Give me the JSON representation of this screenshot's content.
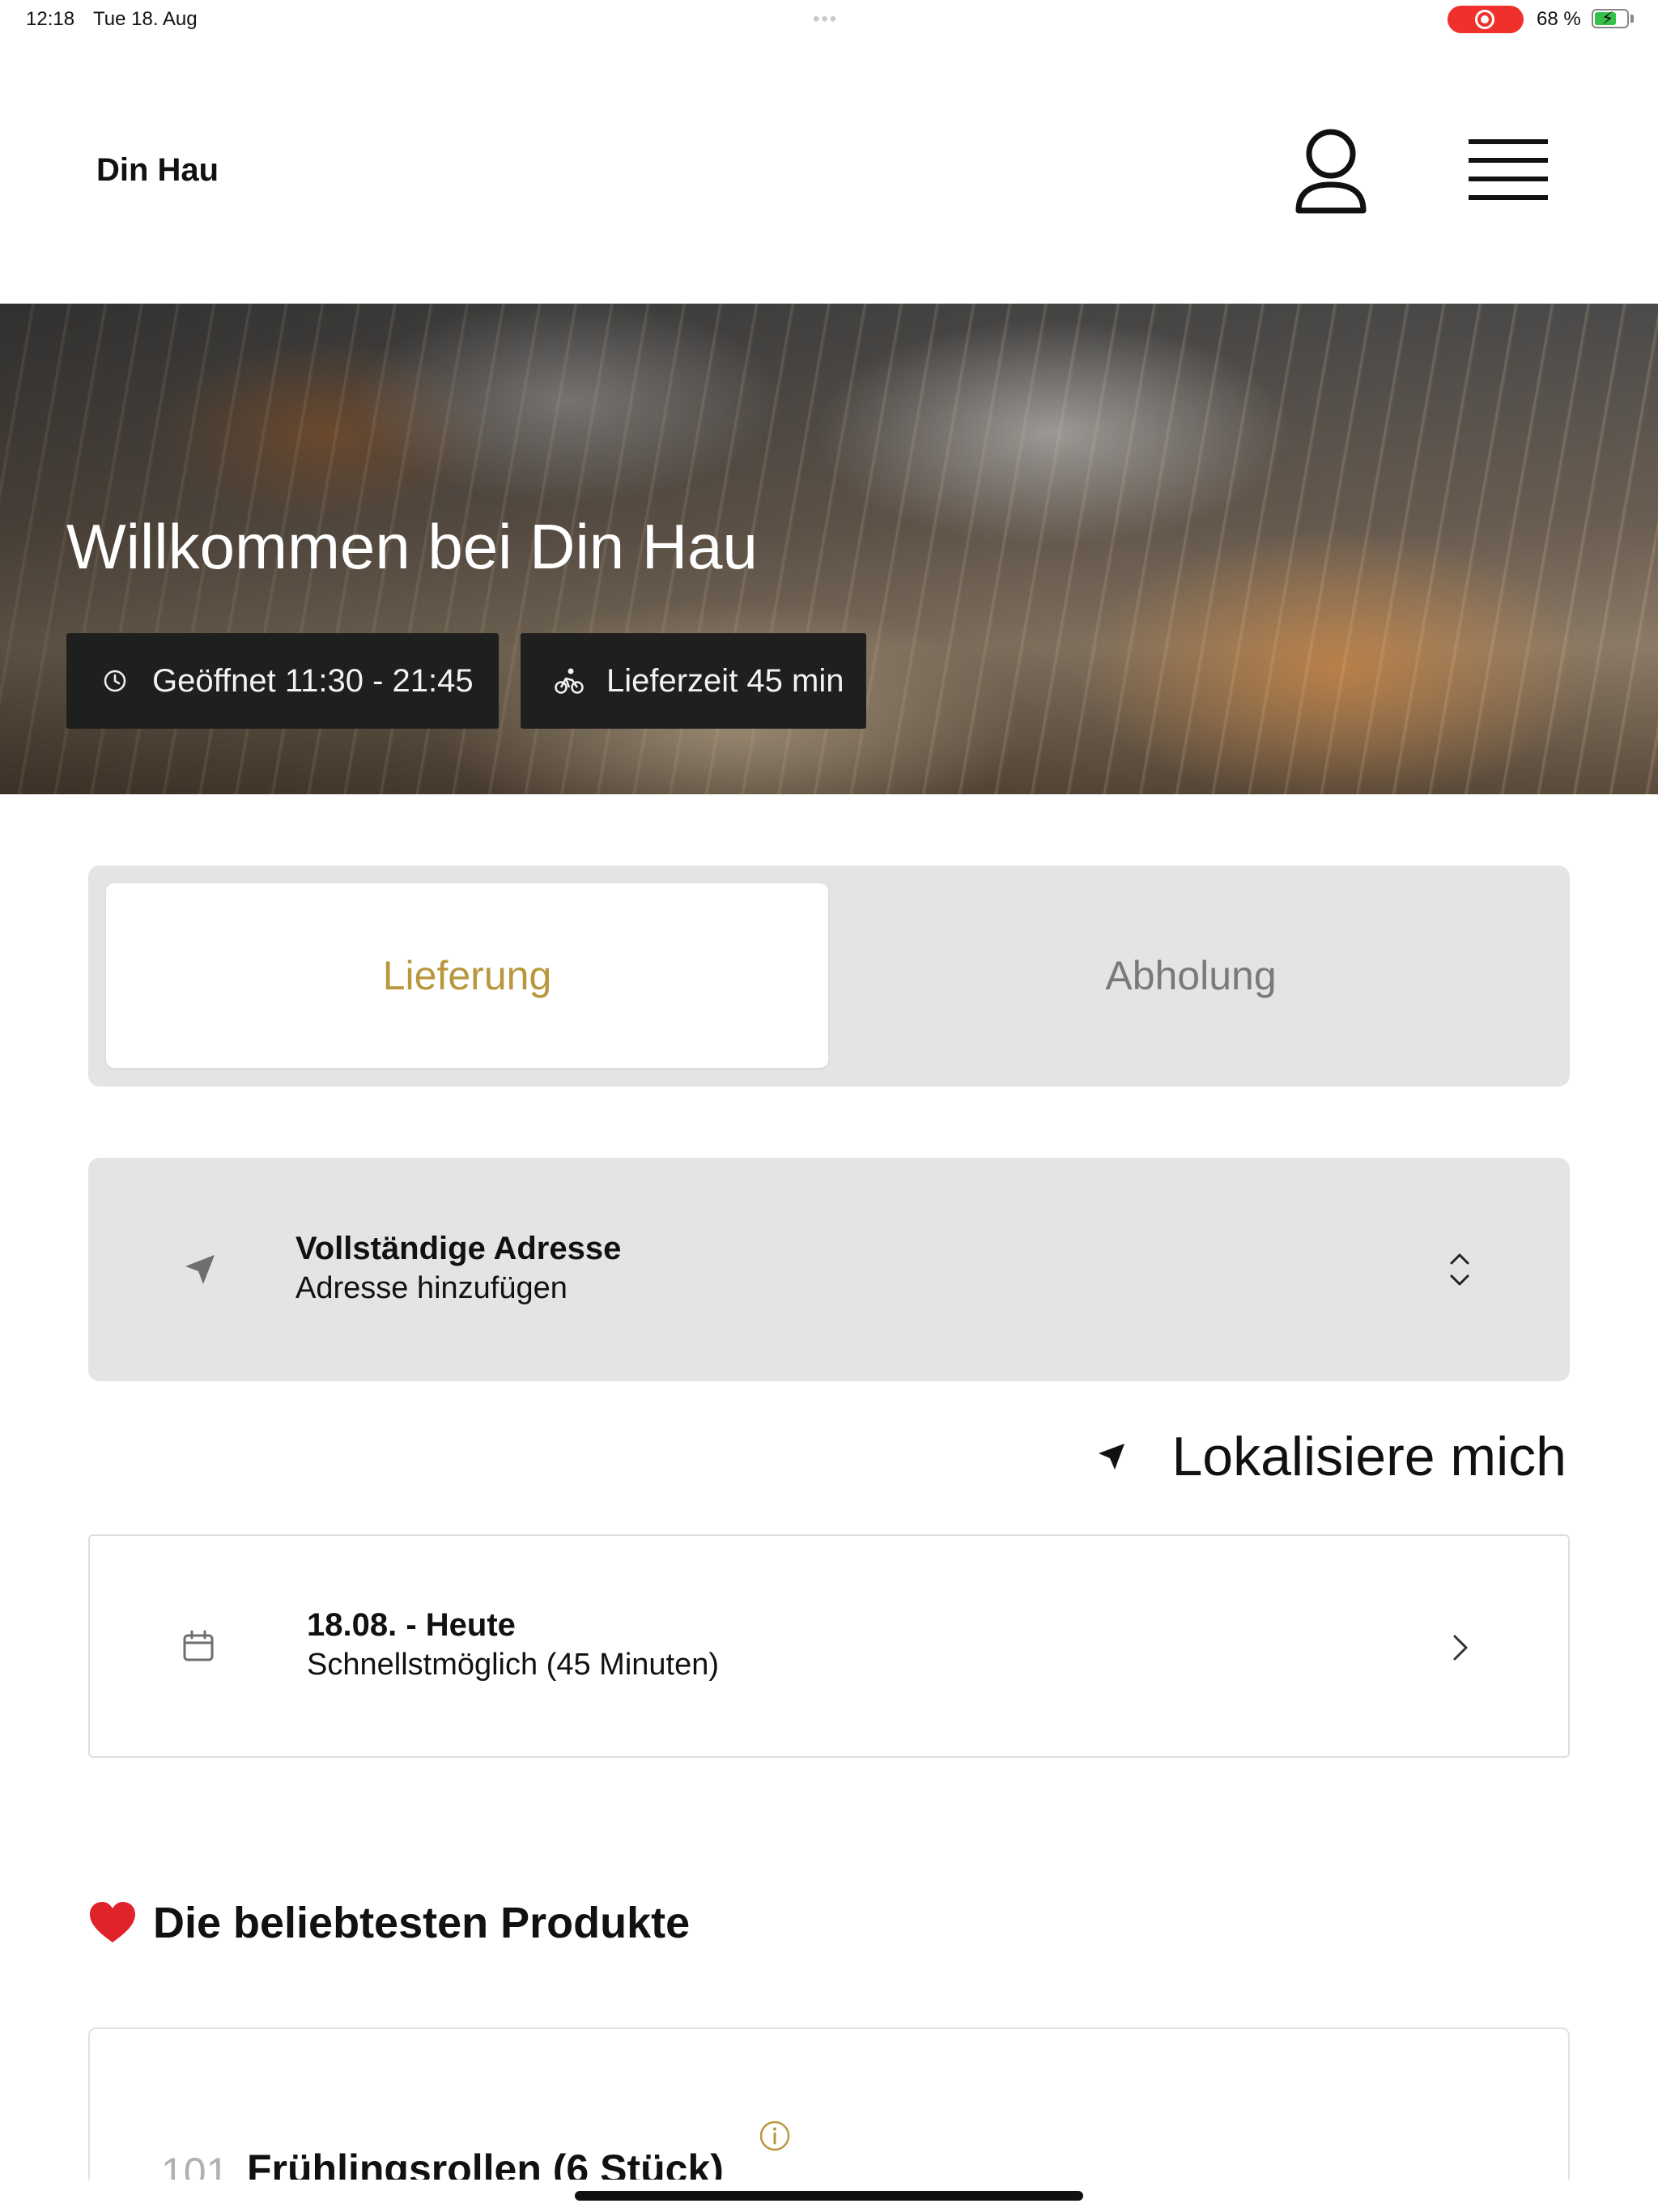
{
  "status_bar": {
    "time": "12:18",
    "date": "Tue 18. Aug",
    "battery": "68 %",
    "battery_level": 0.68,
    "recording_color": "#f0302a"
  },
  "header": {
    "brand": "Din Hau",
    "profile_icon": "person-icon",
    "menu_icon": "hamburger-menu-icon"
  },
  "hero": {
    "title": "Willkommen bei Din Hau",
    "opening_hours": "Geöffnet 11:30 - 21:45",
    "delivery_time": "Lieferzeit 45 min",
    "opening_icon": "clock-icon",
    "delivery_icon": "bicycle-icon"
  },
  "order_mode": {
    "delivery": "Lieferung",
    "pickup": "Abholung",
    "selected": "delivery",
    "accent_color": "#b8973d"
  },
  "address": {
    "title": "Vollständige Adresse",
    "placeholder": "Adresse hinzufügen",
    "icon": "location-arrow-icon"
  },
  "locate": {
    "label": "Lokalisiere mich"
  },
  "schedule": {
    "title": "18.08. - Heute",
    "subtitle": "Schnellstmöglich (45 Minuten)",
    "icon": "calendar-icon"
  },
  "popular": {
    "title": "Die beliebtesten Produkte",
    "icon": "heart-icon",
    "products": [
      {
        "number": "101",
        "name": "Frühlingsrollen (6 Stück)"
      }
    ]
  }
}
